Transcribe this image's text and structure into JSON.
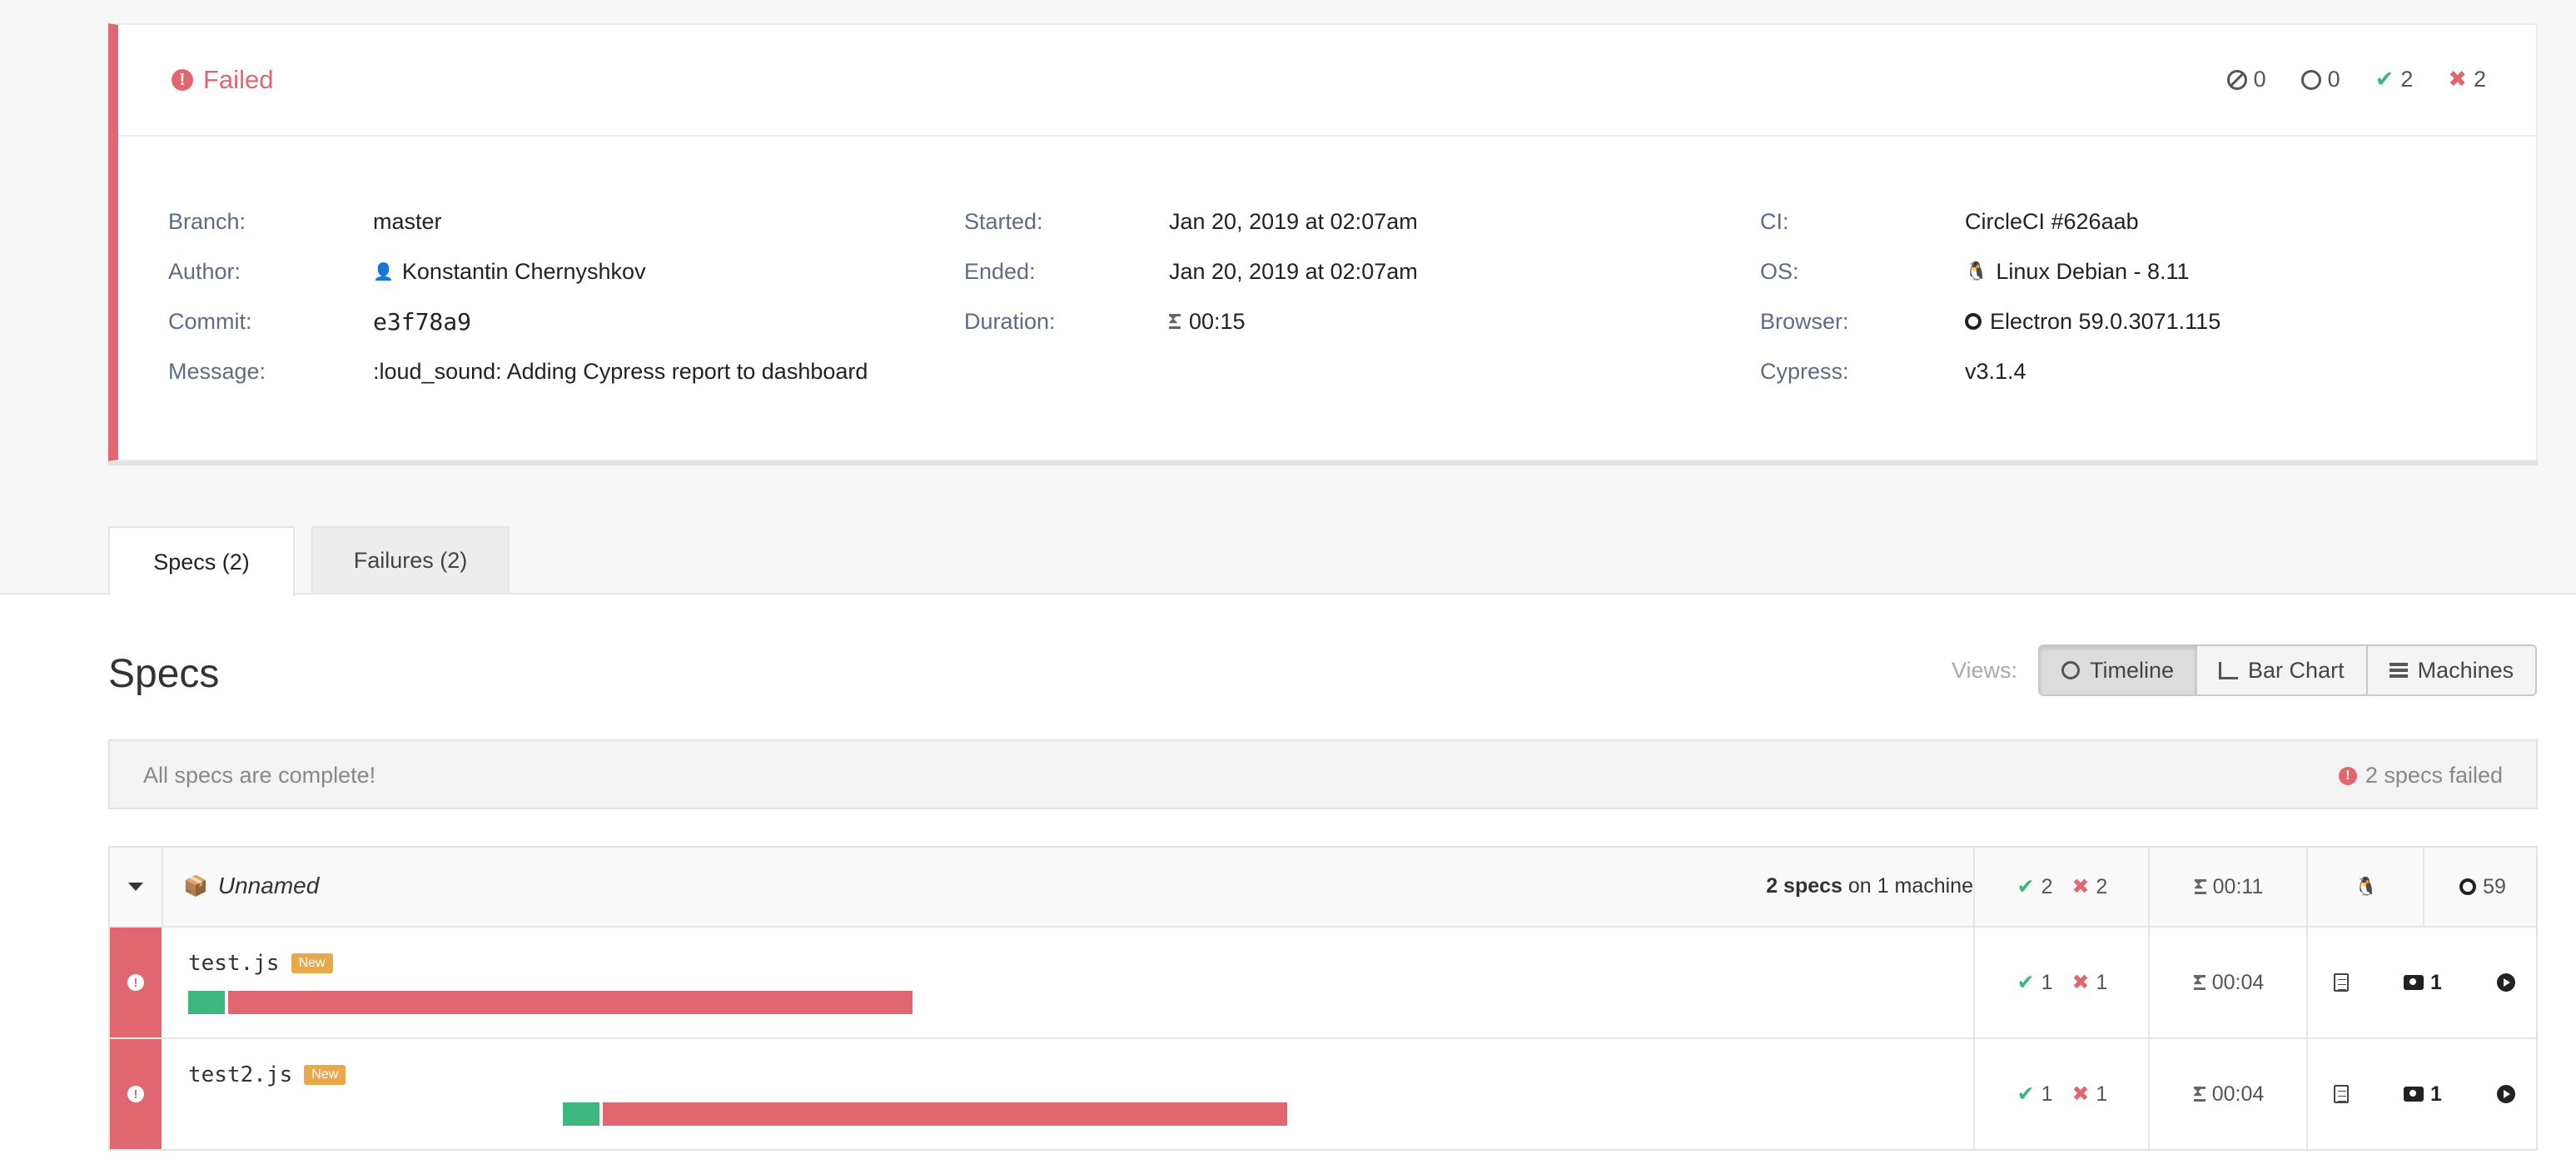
{
  "run": {
    "status": "Failed",
    "stats": {
      "skipped": "0",
      "pending": "0",
      "passed": "2",
      "failed": "2"
    },
    "left": [
      {
        "label": "Branch:",
        "value": "master"
      },
      {
        "label": "Author:",
        "value": "Konstantin Chernyshkov"
      },
      {
        "label": "Commit:",
        "value": "e3f78a9"
      },
      {
        "label": "Message:",
        "value": ":loud_sound: Adding Cypress report to dashboard"
      }
    ],
    "middle": [
      {
        "label": "Started:",
        "value": "Jan 20, 2019 at 02:07am"
      },
      {
        "label": "Ended:",
        "value": "Jan 20, 2019 at 02:07am"
      },
      {
        "label": "Duration:",
        "value": "00:15"
      }
    ],
    "right": [
      {
        "label": "CI:",
        "value": "CircleCI #626aab"
      },
      {
        "label": "OS:",
        "value": "Linux Debian - 8.11"
      },
      {
        "label": "Browser:",
        "value": "Electron 59.0.3071.115"
      },
      {
        "label": "Cypress:",
        "value": "v3.1.4"
      }
    ]
  },
  "tabs": [
    "Specs (2)",
    "Failures (2)"
  ],
  "specs_section": {
    "title": "Specs",
    "views_label": "Views:",
    "views": [
      "Timeline",
      "Bar Chart",
      "Machines"
    ],
    "banner_message": "All specs are complete!",
    "banner_failed": "2 specs failed"
  },
  "group": {
    "name": "Unnamed",
    "count_bold": "2 specs",
    "count_rest": "on 1 machine",
    "passed": "2",
    "failed": "2",
    "duration": "00:11",
    "browser_version": "59"
  },
  "specs": [
    {
      "name": "test.js",
      "badge": "New",
      "passed": "1",
      "failed": "1",
      "duration": "00:04",
      "screenshots": "1",
      "timeline": {
        "start": 0.0,
        "pass": 0.05,
        "fail": 0.95
      }
    },
    {
      "name": "test2.js",
      "badge": "New",
      "passed": "1",
      "failed": "1",
      "duration": "00:04",
      "screenshots": "1",
      "timeline": {
        "start": 0.5,
        "pass": 0.05,
        "fail": 0.95
      }
    }
  ],
  "colors": {
    "failed": "#e06670",
    "passed": "#3eb77f",
    "link": "#3d73c3",
    "badge": "#e9a84a"
  }
}
